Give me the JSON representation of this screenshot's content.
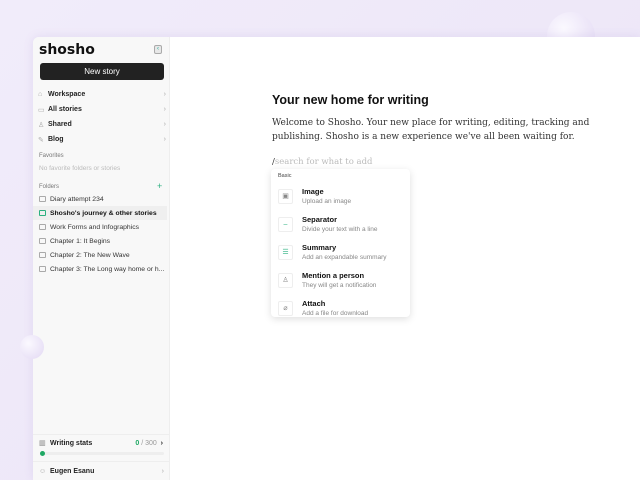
{
  "sidebar": {
    "logo": "shosho",
    "new_story": "New story",
    "nav": [
      {
        "label": "Workspace",
        "icon": "home-icon"
      },
      {
        "label": "All stories",
        "icon": "document-icon"
      },
      {
        "label": "Shared",
        "icon": "users-icon"
      },
      {
        "label": "Blog",
        "icon": "pen-icon"
      }
    ],
    "favorites_title": "Favorites",
    "favorites_empty": "No favorite folders or stories",
    "folders_title": "Folders",
    "folders": [
      "Diary attempt 234",
      "Shosho's journey & other stories",
      "Work Forms and Infographics",
      "Chapter 1: It Begins",
      "Chapter 2: The New Wave",
      "Chapter 3: The Long way home or h..."
    ],
    "stats": {
      "label": "Writing stats",
      "current": "0",
      "total": "/ 300",
      "progress": 0
    },
    "user": "Eugen Esanu"
  },
  "main": {
    "title": "Your new home for writing",
    "intro": "Welcome to Shosho. Your new place for writing, editing, tracking and publishing. Shosho is a new experience we've all been waiting for.",
    "slash": "/",
    "search_placeholder": "search for what to add",
    "menu": {
      "section": "Basic",
      "items": [
        {
          "title": "Image",
          "desc": "Upload an image",
          "icon": "image-icon"
        },
        {
          "title": "Separator",
          "desc": "Divide your text with a line",
          "icon": "separator-icon"
        },
        {
          "title": "Summary",
          "desc": "Add an expandable summary",
          "icon": "summary-icon"
        },
        {
          "title": "Mention a person",
          "desc": "They will get a notification",
          "icon": "mention-icon"
        },
        {
          "title": "Attach",
          "desc": "Add a file for download",
          "icon": "paperclip-icon"
        }
      ]
    }
  },
  "colors": {
    "accent": "#2bb07f",
    "background": "#efe9f8"
  }
}
